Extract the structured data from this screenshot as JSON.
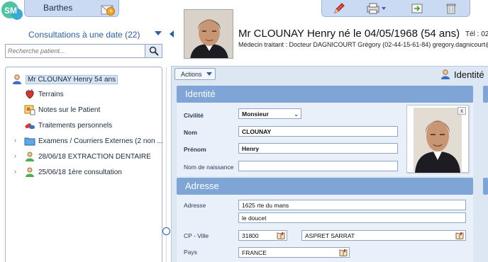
{
  "app": {
    "logo_text": "SM",
    "user_name": "Barthes"
  },
  "toolbar": {
    "icons": [
      "pen-icon",
      "print-icon",
      "export-icon",
      "trash-icon"
    ]
  },
  "sidebar": {
    "consult_link": "Consultations à une date (22)",
    "search_placeholder": "Recherche patient...",
    "tree": [
      {
        "label": "Mr CLOUNAY Henry 54 ans",
        "icon": "patient-icon",
        "selected": true
      },
      {
        "label": "Terrains",
        "icon": "heart-icon"
      },
      {
        "label": "Notes sur le Patient",
        "icon": "notes-icon"
      },
      {
        "label": "Traitements personnels",
        "icon": "pills-icon"
      },
      {
        "label": "Examens / Courriers Externes (2 non ...",
        "icon": "folder-icon",
        "expandable": true
      },
      {
        "label": "28/06/18 EXTRACTION DENTAIRE",
        "icon": "consult-icon",
        "expandable": true
      },
      {
        "label": "25/06/18 1ère consultation",
        "icon": "consult-icon",
        "expandable": true
      }
    ]
  },
  "patient": {
    "title": "Mr CLOUNAY Henry né le 04/05/1968 (54 ans)",
    "doctor_line": "Médecin traitant : Docteur DAGNICOURT Grégory (02-44-15-61-84) gregory.dagnicourt@",
    "tel": "Tél : 02"
  },
  "actions": {
    "label": "Actions",
    "panel_title": "Identité"
  },
  "identite": {
    "section_title": "Identité",
    "civilite_label": "Civilité",
    "civilite_value": "Monsieur",
    "nom_label": "Nom",
    "nom_value": "CLOUNAY",
    "prenom_label": "Prénom",
    "prenom_value": "Henry",
    "naissance_label": "Nom de naissance",
    "naissance_value": "",
    "photo_close": "x"
  },
  "adresse": {
    "section_title": "Adresse",
    "adresse_label": "Adresse",
    "line1": "1625 rte du mans",
    "line2": "le doucet",
    "cp_label": "CP - Ville",
    "cp_value": "31800",
    "ville_value": "ASPRET SARRAT",
    "pays_label": "Pays",
    "pays_value": "FRANCE"
  }
}
